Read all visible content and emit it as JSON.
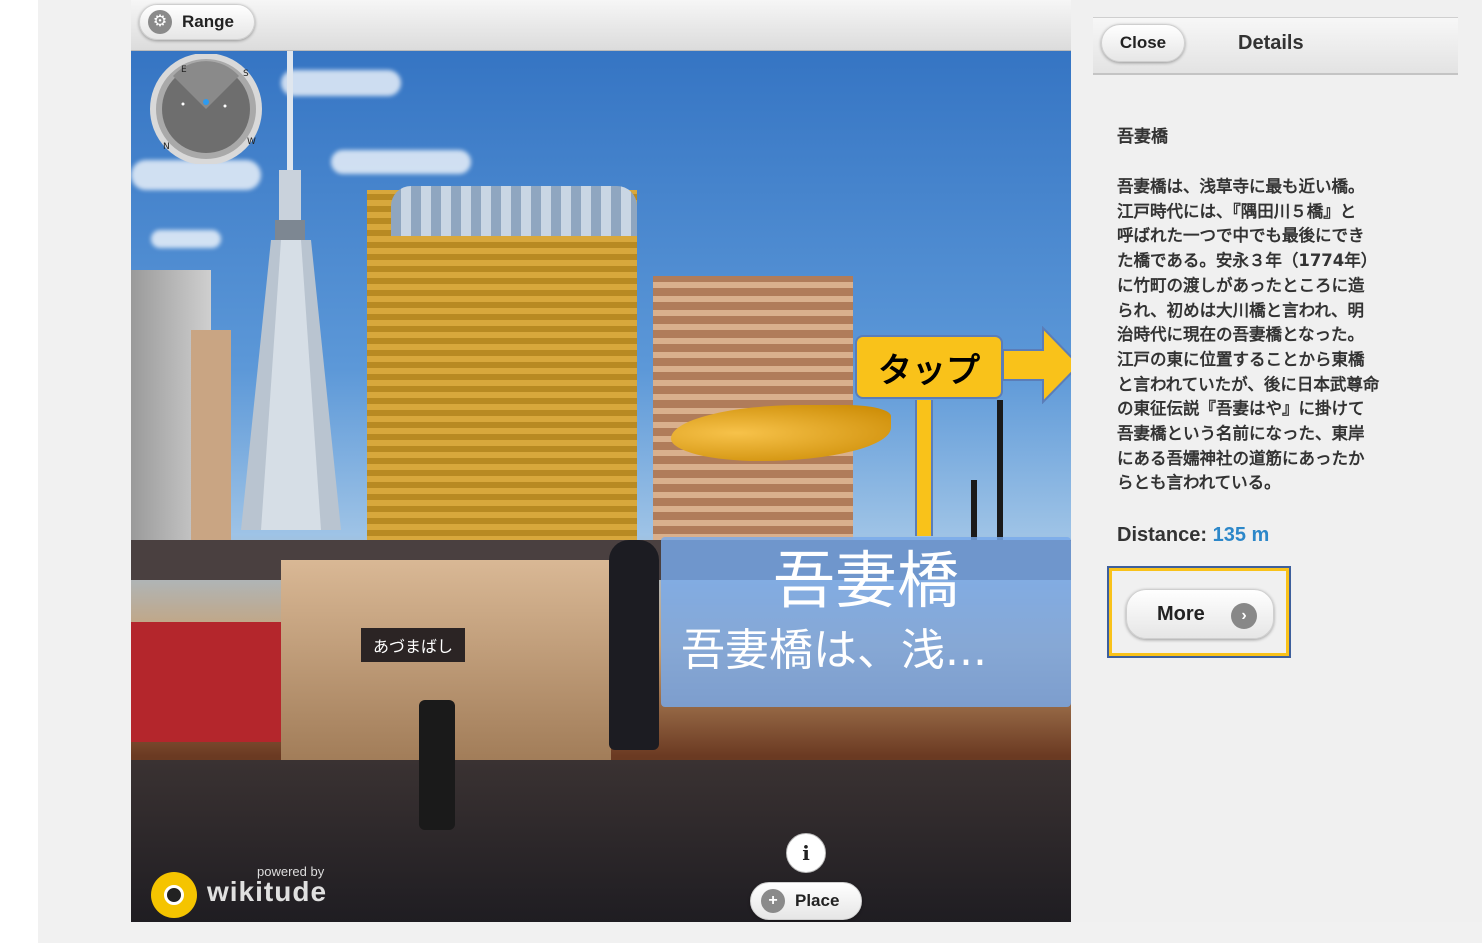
{
  "ar_view": {
    "range_label": "Range",
    "compass_letters": [
      "E",
      "S",
      "W",
      "N"
    ],
    "poi_label": {
      "title": "吾妻橋",
      "subtitle": "吾妻橋は、浅..."
    },
    "sign_plate_text": "あづまばし",
    "place_label": "Place",
    "info_icon_glyph": "i",
    "branding": {
      "powered_by": "powered by",
      "name": "wikitude"
    }
  },
  "annotation": {
    "tap_label": "タップ",
    "color": "#f9c21a"
  },
  "details": {
    "close_label": "Close",
    "title": "Details",
    "place_name": "吾妻橋",
    "description": "吾妻橋は、浅草寺に最も近い橋。\n江戸時代には、『隅田川５橋』と\n呼ばれた一つで中でも最後にでき\nた橋である。安永３年（1774年）\nに竹町の渡しがあったところに造\nられ、初めは大川橋と言われ、明\n治時代に現在の吾妻橋となった。\n江戸の東に位置することから東橋\nと言われていたが、後に日本武尊命\nの東征伝説『吾妻はや』に掛けて\n吾妻橋という名前になった、東岸\nにある吾嬬神社の道筋にあったか\nらとも言われている。",
    "distance_label": "Distance:",
    "distance_value": "135 m",
    "more_label": "More",
    "distance_color": "#2c87c9"
  }
}
